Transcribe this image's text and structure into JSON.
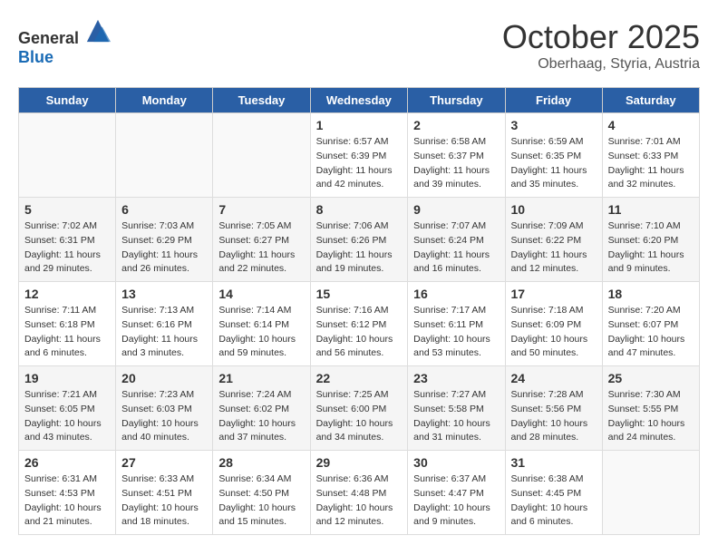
{
  "header": {
    "logo": {
      "general": "General",
      "blue": "Blue"
    },
    "month": "October 2025",
    "location": "Oberhaag, Styria, Austria"
  },
  "weekdays": [
    "Sunday",
    "Monday",
    "Tuesday",
    "Wednesday",
    "Thursday",
    "Friday",
    "Saturday"
  ],
  "weeks": [
    [
      {
        "day": "",
        "info": ""
      },
      {
        "day": "",
        "info": ""
      },
      {
        "day": "",
        "info": ""
      },
      {
        "day": "1",
        "info": "Sunrise: 6:57 AM\nSunset: 6:39 PM\nDaylight: 11 hours\nand 42 minutes."
      },
      {
        "day": "2",
        "info": "Sunrise: 6:58 AM\nSunset: 6:37 PM\nDaylight: 11 hours\nand 39 minutes."
      },
      {
        "day": "3",
        "info": "Sunrise: 6:59 AM\nSunset: 6:35 PM\nDaylight: 11 hours\nand 35 minutes."
      },
      {
        "day": "4",
        "info": "Sunrise: 7:01 AM\nSunset: 6:33 PM\nDaylight: 11 hours\nand 32 minutes."
      }
    ],
    [
      {
        "day": "5",
        "info": "Sunrise: 7:02 AM\nSunset: 6:31 PM\nDaylight: 11 hours\nand 29 minutes."
      },
      {
        "day": "6",
        "info": "Sunrise: 7:03 AM\nSunset: 6:29 PM\nDaylight: 11 hours\nand 26 minutes."
      },
      {
        "day": "7",
        "info": "Sunrise: 7:05 AM\nSunset: 6:27 PM\nDaylight: 11 hours\nand 22 minutes."
      },
      {
        "day": "8",
        "info": "Sunrise: 7:06 AM\nSunset: 6:26 PM\nDaylight: 11 hours\nand 19 minutes."
      },
      {
        "day": "9",
        "info": "Sunrise: 7:07 AM\nSunset: 6:24 PM\nDaylight: 11 hours\nand 16 minutes."
      },
      {
        "day": "10",
        "info": "Sunrise: 7:09 AM\nSunset: 6:22 PM\nDaylight: 11 hours\nand 12 minutes."
      },
      {
        "day": "11",
        "info": "Sunrise: 7:10 AM\nSunset: 6:20 PM\nDaylight: 11 hours\nand 9 minutes."
      }
    ],
    [
      {
        "day": "12",
        "info": "Sunrise: 7:11 AM\nSunset: 6:18 PM\nDaylight: 11 hours\nand 6 minutes."
      },
      {
        "day": "13",
        "info": "Sunrise: 7:13 AM\nSunset: 6:16 PM\nDaylight: 11 hours\nand 3 minutes."
      },
      {
        "day": "14",
        "info": "Sunrise: 7:14 AM\nSunset: 6:14 PM\nDaylight: 10 hours\nand 59 minutes."
      },
      {
        "day": "15",
        "info": "Sunrise: 7:16 AM\nSunset: 6:12 PM\nDaylight: 10 hours\nand 56 minutes."
      },
      {
        "day": "16",
        "info": "Sunrise: 7:17 AM\nSunset: 6:11 PM\nDaylight: 10 hours\nand 53 minutes."
      },
      {
        "day": "17",
        "info": "Sunrise: 7:18 AM\nSunset: 6:09 PM\nDaylight: 10 hours\nand 50 minutes."
      },
      {
        "day": "18",
        "info": "Sunrise: 7:20 AM\nSunset: 6:07 PM\nDaylight: 10 hours\nand 47 minutes."
      }
    ],
    [
      {
        "day": "19",
        "info": "Sunrise: 7:21 AM\nSunset: 6:05 PM\nDaylight: 10 hours\nand 43 minutes."
      },
      {
        "day": "20",
        "info": "Sunrise: 7:23 AM\nSunset: 6:03 PM\nDaylight: 10 hours\nand 40 minutes."
      },
      {
        "day": "21",
        "info": "Sunrise: 7:24 AM\nSunset: 6:02 PM\nDaylight: 10 hours\nand 37 minutes."
      },
      {
        "day": "22",
        "info": "Sunrise: 7:25 AM\nSunset: 6:00 PM\nDaylight: 10 hours\nand 34 minutes."
      },
      {
        "day": "23",
        "info": "Sunrise: 7:27 AM\nSunset: 5:58 PM\nDaylight: 10 hours\nand 31 minutes."
      },
      {
        "day": "24",
        "info": "Sunrise: 7:28 AM\nSunset: 5:56 PM\nDaylight: 10 hours\nand 28 minutes."
      },
      {
        "day": "25",
        "info": "Sunrise: 7:30 AM\nSunset: 5:55 PM\nDaylight: 10 hours\nand 24 minutes."
      }
    ],
    [
      {
        "day": "26",
        "info": "Sunrise: 6:31 AM\nSunset: 4:53 PM\nDaylight: 10 hours\nand 21 minutes."
      },
      {
        "day": "27",
        "info": "Sunrise: 6:33 AM\nSunset: 4:51 PM\nDaylight: 10 hours\nand 18 minutes."
      },
      {
        "day": "28",
        "info": "Sunrise: 6:34 AM\nSunset: 4:50 PM\nDaylight: 10 hours\nand 15 minutes."
      },
      {
        "day": "29",
        "info": "Sunrise: 6:36 AM\nSunset: 4:48 PM\nDaylight: 10 hours\nand 12 minutes."
      },
      {
        "day": "30",
        "info": "Sunrise: 6:37 AM\nSunset: 4:47 PM\nDaylight: 10 hours\nand 9 minutes."
      },
      {
        "day": "31",
        "info": "Sunrise: 6:38 AM\nSunset: 4:45 PM\nDaylight: 10 hours\nand 6 minutes."
      },
      {
        "day": "",
        "info": ""
      }
    ]
  ]
}
